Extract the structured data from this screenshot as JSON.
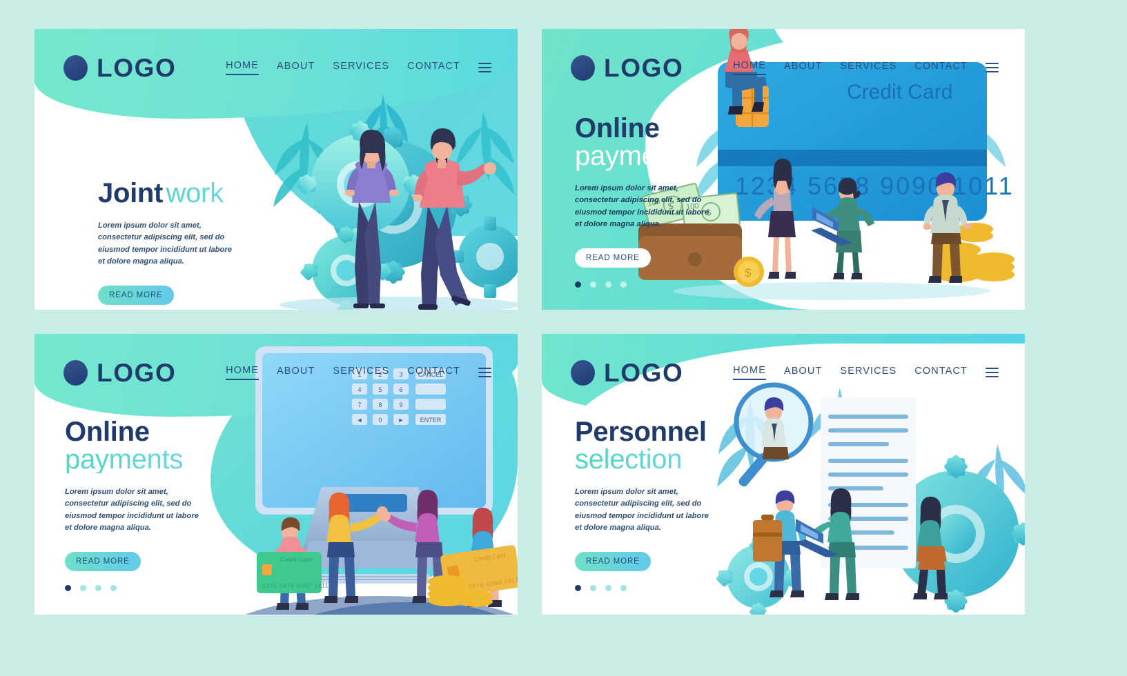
{
  "page": {
    "background_color": "#c9ece7",
    "layout": "2x2 grid of landing-page templates"
  },
  "brand": {
    "logo_text": "LOGO",
    "logo_icon": "circle-logo-mark",
    "navy": "#1f3a6b",
    "teal": "#5fd8d2",
    "accent_blue": "#63c9ea"
  },
  "nav": {
    "items": [
      {
        "label": "HOME",
        "active": true
      },
      {
        "label": "ABOUT",
        "active": false
      },
      {
        "label": "SERVICES",
        "active": false
      },
      {
        "label": "CONTACT",
        "active": false
      }
    ],
    "menu_icon": "hamburger-menu-icon"
  },
  "shared": {
    "lorem": "Lorem ipsum dolor sit amet, consectetur adipiscing elit, sed do eiusmod tempor incididunt ut labore et dolore magna aliqua.",
    "read_more": "READ MORE",
    "dots_count": 4,
    "active_dot": 0
  },
  "panels": [
    {
      "id": "joint-work",
      "title_line1": "Joint",
      "title_line2": "work",
      "title_style": "navy + teal on one line",
      "button_style": "gradient",
      "illustration": "two people standing in front of large teal gears with palm leaves",
      "illustration_items": [
        "gear-large",
        "gear-medium",
        "gear-small",
        "palm-leaf",
        "person-woman",
        "person-man"
      ]
    },
    {
      "id": "online-payments-credit-card",
      "title_line1": "Online",
      "title_line2": "payments",
      "title_style": "navy + white on teal background",
      "button_style": "white",
      "illustration": "giant blue credit card with people, wallet, cash and gold coins",
      "illustration_items": [
        "credit-card",
        "wallet",
        "banknotes",
        "gold-coins",
        "laptop",
        "person-sitting",
        "person-woman",
        "person-man"
      ],
      "card_label": "Credit Card",
      "card_number": "1234  5678  9090  1011",
      "banknote_value": "100"
    },
    {
      "id": "online-payments-atm",
      "title_line1": "Online",
      "title_line2": "payments",
      "title_style": "navy + teal gradient",
      "button_style": "gradient",
      "illustration": "ATM terminal with keypad, people holding credit cards and gold coins",
      "illustration_items": [
        "atm-terminal",
        "keypad",
        "person-man",
        "person-woman",
        "credit-card-green",
        "credit-card-orange",
        "gold-coins"
      ],
      "keypad_keys": [
        "1",
        "2",
        "3",
        "CANCEL",
        "4",
        "5",
        "6",
        "",
        "7",
        "8",
        "9",
        "",
        "◄",
        "0",
        "►",
        "ENTER"
      ],
      "card_label": "Credit Card",
      "card_number": "1234  5678  9090  1011"
    },
    {
      "id": "personnel-selection",
      "title_line1": "Personnel",
      "title_line2": "selection",
      "title_style": "navy + teal gradient",
      "button_style": "gradient",
      "illustration": "people reviewing a large CV document with a magnifying glass and gears",
      "illustration_items": [
        "document-cv",
        "magnifier",
        "gear-large",
        "gear-small",
        "palm-leaf",
        "person-man",
        "person-woman",
        "laptop",
        "briefcase"
      ]
    }
  ]
}
